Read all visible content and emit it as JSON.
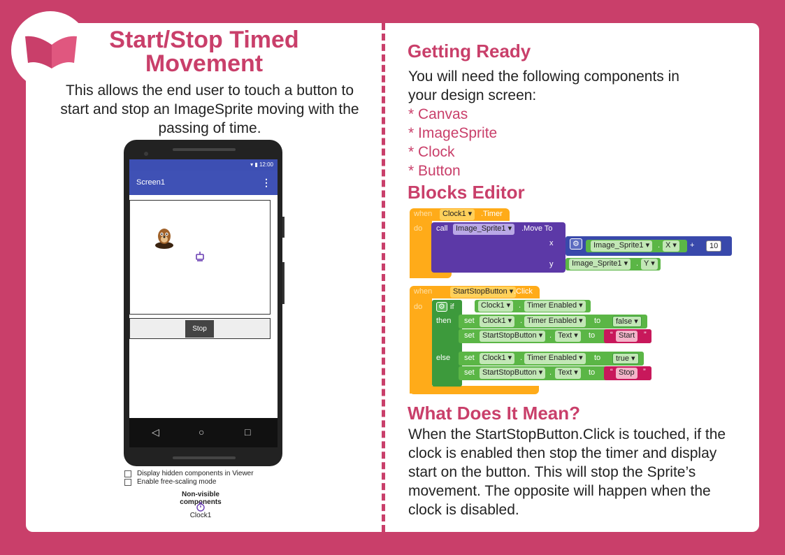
{
  "left": {
    "title": "Start/Stop Timed Movement",
    "description": "This allows the end user to touch a button to start and stop an ImageSprite moving with the passing of time.",
    "phone": {
      "status_time": "12:00",
      "screen_title": "Screen1",
      "menu_glyph": "⋮",
      "button_text": "Stop",
      "nav_back": "◁",
      "nav_home": "○",
      "nav_recent": "□"
    },
    "viewer_options": [
      "Display hidden components in Viewer",
      "Enable free-scaling mode"
    ],
    "nonvisible_header": "Non-visible components",
    "nonvisible_items": [
      "Clock1"
    ]
  },
  "right": {
    "getting_ready_heading": "Getting Ready",
    "getting_ready_text": "You will need the following components in your design screen:",
    "components": [
      "* Canvas",
      "* ImageSprite",
      "* Clock",
      "* Button"
    ],
    "blocks_heading": "Blocks Editor",
    "meaning_heading": "What Does It Mean?",
    "meaning_text": "When the StartStopButton.Click is touched, if the clock is enabled then stop the timer and display start on the button. This will stop the Sprite’s movement. The opposite will happen when the clock is disabled."
  },
  "blocks": {
    "when": "when",
    "do": "do",
    "clock1": "Clock1",
    "timer_event": ".Timer",
    "call": "call",
    "image_sprite": "Image_Sprite1",
    "move_to": ".Move To",
    "x": "x",
    "y": "y",
    "xprop": "X",
    "yprop": "Y",
    "plus": "+",
    "ten": "10",
    "startstop": "StartStopButton",
    "click_event": ".Click",
    "if": "if",
    "then": "then",
    "else": "else",
    "set": "set",
    "timer_enabled": "Timer Enabled",
    "to": "to",
    "false": "false",
    "true": "true",
    "text": "Text",
    "start_str": "Start",
    "stop_str": "Stop",
    "dot": "."
  },
  "colors": {
    "brand": "#c93f6a",
    "event_orange": "#ffab19",
    "procedure_purple": "#5c39a7",
    "math_indigo": "#3949ab",
    "component_green": "#5bb646",
    "text_pink": "#c8185b"
  }
}
